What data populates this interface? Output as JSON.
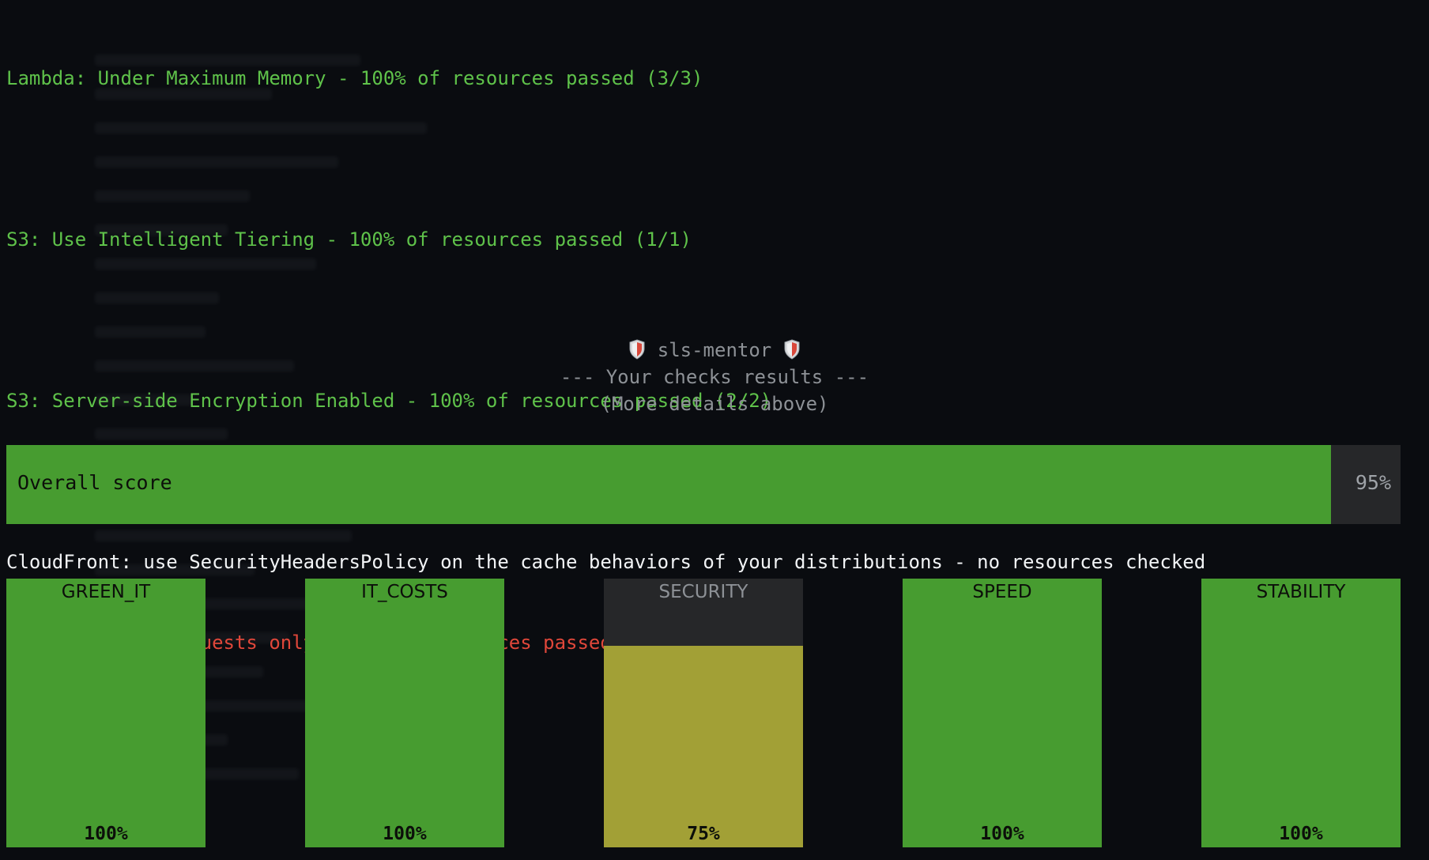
{
  "log_lines": [
    {
      "text": "Lambda: Under Maximum Memory - 100% of resources passed (3/3)",
      "status": "pass"
    },
    {
      "text": "S3: Use Intelligent Tiering - 100% of resources passed (1/1)",
      "status": "pass"
    },
    {
      "text": "S3: Server-side Encryption Enabled - 100% of resources passed (2/2)",
      "status": "pass"
    },
    {
      "text": "CloudFront: use SecurityHeadersPolicy on the cache behaviors of your distributions - no resources checked",
      "status": "neutral"
    },
    {
      "text": "S3: Use HTTPS requests only - 50% of resources passed (1/2)",
      "status": "fail"
    }
  ],
  "banner": {
    "title": "sls-mentor",
    "subtitle": "--- Your checks results ---",
    "note": "(More details above)"
  },
  "overall": {
    "label": "Overall score",
    "value_text": "95%",
    "value": 0.95
  },
  "categories": [
    {
      "name": "GREEN_IT",
      "value_text": "100%",
      "value": 1.0,
      "color": "#479c30"
    },
    {
      "name": "IT_COSTS",
      "value_text": "100%",
      "value": 1.0,
      "color": "#479c30"
    },
    {
      "name": "SECURITY",
      "value_text": "75%",
      "value": 0.75,
      "color": "#a2a036"
    },
    {
      "name": "SPEED",
      "value_text": "100%",
      "value": 1.0,
      "color": "#479c30"
    },
    {
      "name": "STABILITY",
      "value_text": "100%",
      "value": 1.0,
      "color": "#479c30"
    }
  ],
  "colors": {
    "pass": "#5fc24a",
    "neutral": "#f2f4f6",
    "fail": "#e0473a",
    "bar_full": "#479c30",
    "bar_partial": "#a2a036",
    "track": "#262729"
  },
  "icons": {
    "banner_left": "shield-icon",
    "banner_right": "shield-icon"
  }
}
